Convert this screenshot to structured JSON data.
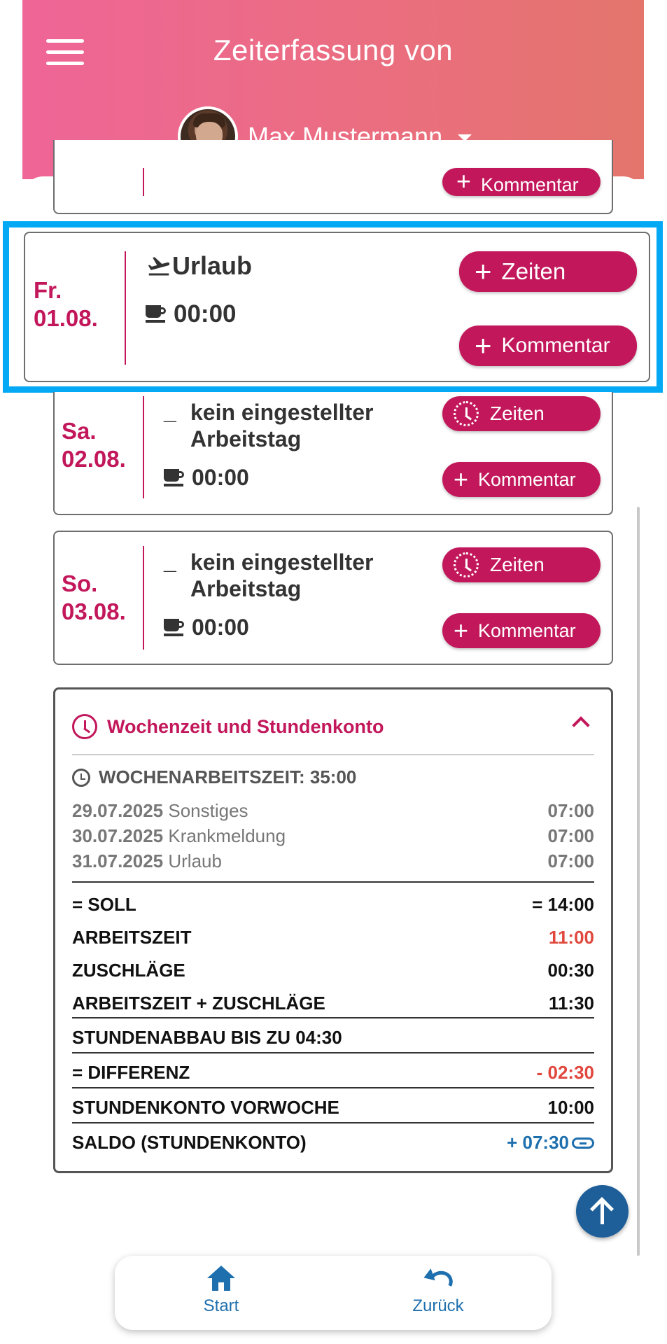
{
  "header": {
    "title": "Zeiterfassung von",
    "user_name": "Max Mustermann"
  },
  "top_card": {
    "comment_label": "Kommentar"
  },
  "days": [
    {
      "weekday": "Fr.",
      "date": "01.08.",
      "type_label": "Urlaub",
      "type_icon": "airplane-departure-icon",
      "pause": "00:00",
      "times_label": "Zeiten",
      "comment_label": "Kommentar"
    },
    {
      "weekday": "Sa.",
      "date": "02.08.",
      "type_label_line1": "kein eingestellter",
      "type_label_line2": "Arbeitstag",
      "type_icon": "dash-icon",
      "pause": "00:00",
      "times_label": "Zeiten",
      "comment_label": "Kommentar"
    },
    {
      "weekday": "So.",
      "date": "03.08.",
      "type_label_line1": "kein eingestellter",
      "type_label_line2": "Arbeitstag",
      "type_icon": "dash-icon",
      "pause": "00:00",
      "times_label": "Zeiten",
      "comment_label": "Kommentar"
    }
  ],
  "summary": {
    "title": "Wochenzeit und Stundenkonto",
    "week_hours": "WOCHENARBEITSZEIT: 35:00",
    "entries": [
      {
        "date": "29.07.2025",
        "label": "Sonstiges",
        "value": "07:00"
      },
      {
        "date": "30.07.2025",
        "label": "Krankmeldung",
        "value": "07:00"
      },
      {
        "date": "31.07.2025",
        "label": "Urlaub",
        "value": "07:00"
      }
    ],
    "rows": [
      {
        "label": "= SOLL",
        "value": "= 14:00"
      },
      {
        "label": "ARBEITSZEIT",
        "value": "11:00"
      },
      {
        "label": "ZUSCHLÄGE",
        "value": "00:30"
      },
      {
        "label": "ARBEITSZEIT + ZUSCHLÄGE",
        "value": "11:30"
      },
      {
        "label": "STUNDENABBAU BIS ZU 04:30",
        "value": ""
      },
      {
        "label": "= DIFFERENZ",
        "value": "- 02:30"
      },
      {
        "label": "STUNDENKONTO VORWOCHE",
        "value": "10:00"
      },
      {
        "label": "SALDO (STUNDENKONTO)",
        "value": "+ 07:30"
      }
    ]
  },
  "nav": {
    "home_label": "Start",
    "back_label": "Zurück"
  },
  "colors": {
    "accent": "#c2185b",
    "header_gradient_start": "#ef6597",
    "header_gradient_end": "#e3756c",
    "highlight": "#03a9f4",
    "link_blue": "#1e6fae",
    "negative_red": "#e0483e"
  }
}
